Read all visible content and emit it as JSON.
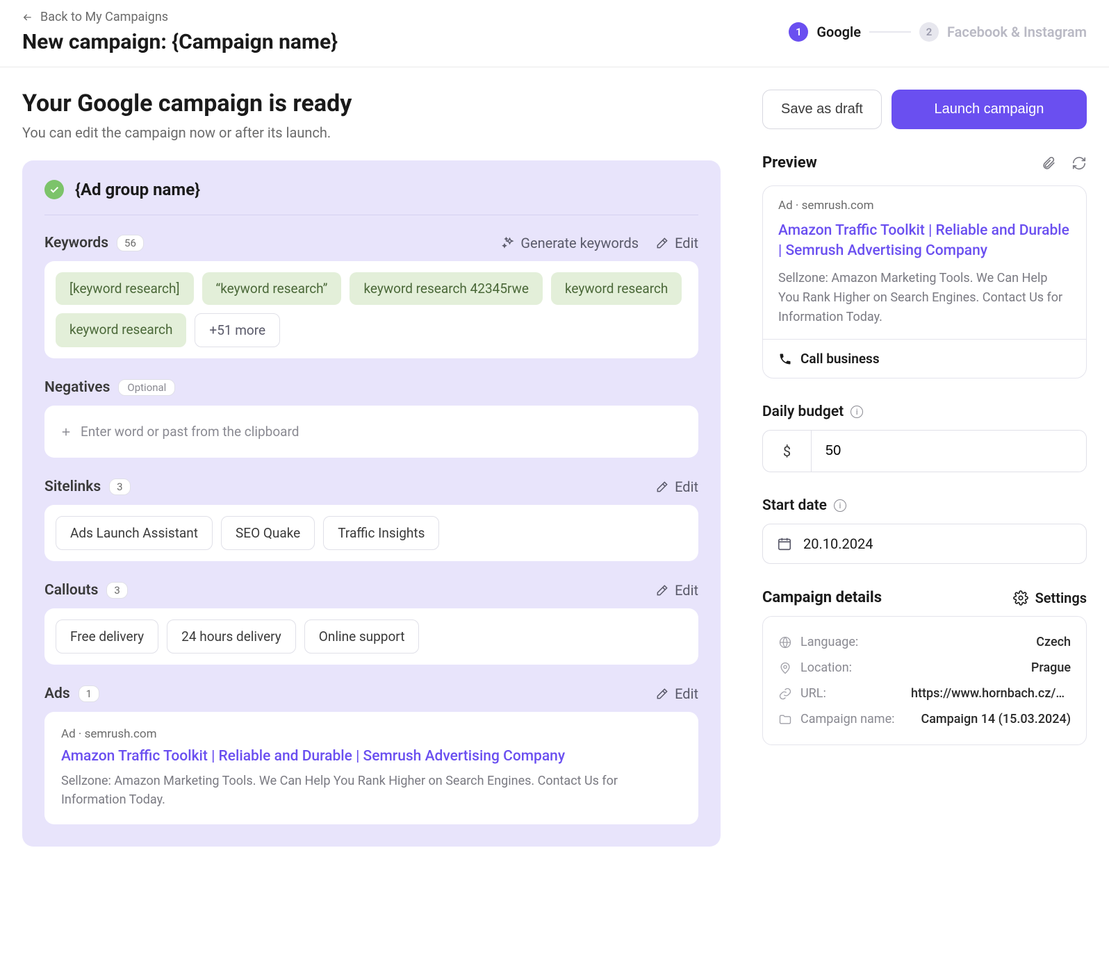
{
  "header": {
    "back_label": "Back to My Campaigns",
    "title": "New campaign: {Campaign name}"
  },
  "stepper": {
    "step1_num": "1",
    "step1_label": "Google",
    "step2_num": "2",
    "step2_label": "Facebook & Instagram"
  },
  "ready": {
    "heading": "Your Google campaign is ready",
    "subtitle": "You can edit the campaign now or after its launch."
  },
  "ad_group": {
    "name": "{Ad group name}",
    "keywords_label": "Keywords",
    "keywords_count": "56",
    "generate_label": "Generate keywords",
    "edit_label": "Edit",
    "keywords": [
      "[keyword research]",
      "“keyword research”",
      "keyword research 42345rwe",
      "keyword research",
      "keyword research"
    ],
    "keywords_more": "+51 more",
    "negatives_label": "Negatives",
    "negatives_optional": "Optional",
    "negatives_placeholder": "Enter word or past from the clipboard",
    "sitelinks_label": "Sitelinks",
    "sitelinks_count": "3",
    "sitelinks": [
      "Ads Launch Assistant",
      "SEO Quake",
      "Traffic Insights"
    ],
    "callouts_label": "Callouts",
    "callouts_count": "3",
    "callouts": [
      "Free delivery",
      "24 hours delivery",
      "Online support"
    ],
    "ads_label": "Ads",
    "ads_count": "1",
    "ad_prefix": "Ad",
    "ad_dot": "·",
    "ad_domain": "semrush.com",
    "ad_headline": "Amazon Traffic Toolkit | Reliable and Durable | Semrush Advertising Company",
    "ad_desc": "Sellzone: Amazon Marketing Tools. We Can Help You Rank Higher on Search Engines. Contact Us for Information Today."
  },
  "right": {
    "save_draft": "Save as draft",
    "launch": "Launch campaign",
    "preview_label": "Preview",
    "preview_ad_prefix": "Ad",
    "preview_ad_dot": "·",
    "preview_domain": "semrush.com",
    "preview_headline": "Amazon Traffic Toolkit | Reliable and Durable | Semrush Advertising Company",
    "preview_desc": "Sellzone: Amazon Marketing Tools. We Can Help You Rank Higher on Search Engines. Contact Us for Information Today.",
    "call_business": "Call business",
    "budget_label": "Daily budget",
    "currency": "$",
    "budget_value": "50",
    "start_date_label": "Start date",
    "start_date_value": "20.10.2024",
    "details_label": "Campaign details",
    "settings_label": "Settings",
    "details": {
      "language_label": "Language:",
      "language_value": "Czech",
      "location_label": "Location:",
      "location_value": "Prague",
      "url_label": "URL:",
      "url_value": "https://www.hornbach.cz/p…",
      "campaign_name_label": "Campaign name:",
      "campaign_name_value": "Campaign 14 (15.03.2024)"
    }
  }
}
